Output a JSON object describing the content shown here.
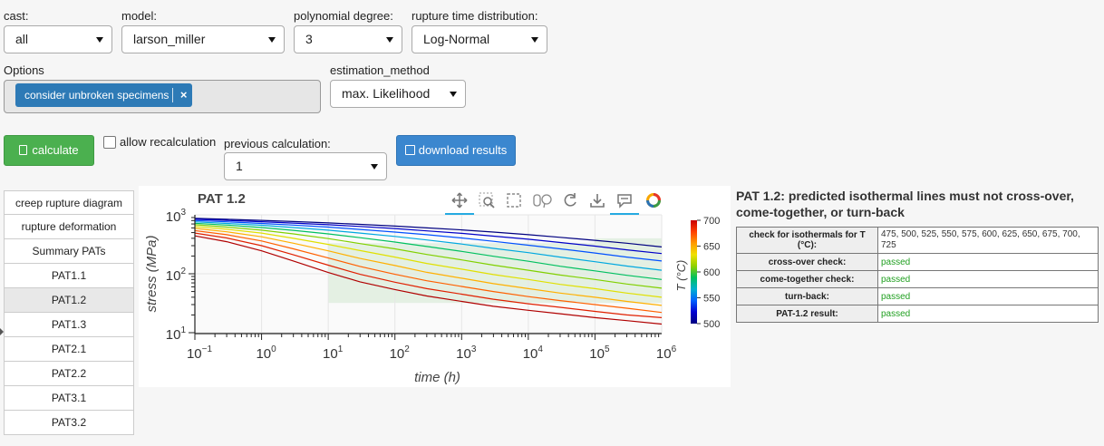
{
  "controls": {
    "cast": {
      "label": "cast:",
      "value": "all"
    },
    "model": {
      "label": "model:",
      "value": "larson_miller"
    },
    "poly_degree": {
      "label": "polynomial degree:",
      "value": "3"
    },
    "rupture_dist": {
      "label": "rupture time distribution:",
      "value": "Log-Normal"
    },
    "options": {
      "label": "Options",
      "chip": "consider unbroken specimens"
    },
    "estimation": {
      "label": "estimation_method",
      "value": "max. Likelihood"
    },
    "calculate_label": "calculate",
    "allow_recalc_label": "allow recalculation",
    "allow_recalc_checked": false,
    "previous": {
      "label": "previous calculation:",
      "value": "1"
    },
    "download_label": "download results"
  },
  "tabs": [
    "creep rupture diagram",
    "rupture deformation",
    "Summary PATs",
    "PAT1.1",
    "PAT1.2",
    "PAT1.3",
    "PAT2.1",
    "PAT2.2",
    "PAT3.1",
    "PAT3.2"
  ],
  "active_tab": "PAT1.2",
  "toolbar": [
    "pan-icon",
    "box-zoom-icon",
    "box-select-icon",
    "lasso-select-icon",
    "reset-icon",
    "save-icon",
    "hover-icon",
    "bokeh-logo-icon"
  ],
  "chart_data": {
    "type": "line",
    "title": "PAT 1.2",
    "xlabel": "time (h)",
    "ylabel": "stress (MPa)",
    "x_scale": "log",
    "y_scale": "log",
    "xlim": [
      0.1,
      1000000
    ],
    "ylim": [
      10,
      1000
    ],
    "x_ticks": [
      {
        "v": 0.1,
        "b": "10",
        "e": "−1"
      },
      {
        "v": 1,
        "b": "10",
        "e": "0"
      },
      {
        "v": 10,
        "b": "10",
        "e": "1"
      },
      {
        "v": 100,
        "b": "10",
        "e": "2"
      },
      {
        "v": 1000,
        "b": "10",
        "e": "3"
      },
      {
        "v": 10000,
        "b": "10",
        "e": "4"
      },
      {
        "v": 100000,
        "b": "10",
        "e": "5"
      },
      {
        "v": 1000000,
        "b": "10",
        "e": "6"
      }
    ],
    "y_ticks": [
      {
        "v": 10,
        "b": "10",
        "e": "1"
      },
      {
        "v": 100,
        "b": "10",
        "e": "2"
      },
      {
        "v": 1000,
        "b": "10",
        "e": "3"
      }
    ],
    "shaded_regions": [
      {
        "x": [
          10,
          1000000
        ],
        "y": [
          32,
          330
        ]
      },
      {
        "x": 100000,
        "x2": 1000000,
        "y": [
          330,
          400
        ]
      }
    ],
    "colorbar": {
      "label": "T (°C)",
      "ticks": [
        "700",
        "650",
        "600",
        "550",
        "500"
      ],
      "min": 500,
      "max": 700
    },
    "x": [
      0.1,
      0.3,
      1,
      3,
      10,
      30,
      100,
      300,
      1000,
      3000,
      10000,
      30000,
      100000,
      300000,
      1000000
    ],
    "series": [
      {
        "temp": 475,
        "color": "#000080",
        "values": [
          870,
          840,
          805,
          770,
          730,
          690,
          645,
          600,
          555,
          510,
          460,
          415,
          370,
          330,
          285
        ]
      },
      {
        "temp": 500,
        "color": "#0000c8",
        "values": [
          840,
          805,
          765,
          725,
          680,
          635,
          585,
          535,
          485,
          435,
          385,
          340,
          295,
          255,
          220
        ]
      },
      {
        "temp": 525,
        "color": "#0050ff",
        "values": [
          800,
          760,
          715,
          670,
          620,
          565,
          510,
          460,
          405,
          355,
          305,
          265,
          225,
          192,
          165
        ]
      },
      {
        "temp": 550,
        "color": "#00a8e0",
        "values": [
          760,
          715,
          665,
          610,
          550,
          490,
          430,
          375,
          320,
          270,
          228,
          192,
          160,
          135,
          115
        ]
      },
      {
        "temp": 575,
        "color": "#00c060",
        "values": [
          720,
          670,
          610,
          545,
          475,
          410,
          345,
          290,
          240,
          198,
          163,
          134,
          112,
          94,
          80
        ]
      },
      {
        "temp": 600,
        "color": "#80d000",
        "values": [
          680,
          620,
          550,
          475,
          395,
          325,
          265,
          213,
          172,
          140,
          115,
          95,
          80,
          67,
          57
        ]
      },
      {
        "temp": 625,
        "color": "#e0e000",
        "values": [
          635,
          570,
          490,
          400,
          315,
          248,
          192,
          150,
          120,
          97,
          80,
          66,
          56,
          47,
          40
        ]
      },
      {
        "temp": 650,
        "color": "#ffb000",
        "values": [
          590,
          515,
          425,
          330,
          245,
          182,
          138,
          106,
          84,
          68,
          56,
          47,
          40,
          34,
          29
        ]
      },
      {
        "temp": 675,
        "color": "#ff6000",
        "values": [
          540,
          460,
          360,
          265,
          185,
          133,
          98,
          76,
          61,
          50,
          41,
          35,
          30,
          26,
          22
        ]
      },
      {
        "temp": 700,
        "color": "#e02000",
        "values": [
          490,
          405,
          300,
          210,
          140,
          98,
          72,
          56,
          45,
          37,
          31,
          27,
          23,
          20,
          18
        ]
      },
      {
        "temp": 725,
        "color": "#b00000",
        "values": [
          440,
          350,
          245,
          165,
          105,
          73,
          54,
          42,
          34,
          28,
          24,
          21,
          18,
          16,
          14
        ]
      }
    ]
  },
  "pat": {
    "title": "PAT 1.2: predicted isothermal lines must not cross-over, come-together, or turn-back",
    "rows": [
      {
        "label": "check for isothermals for T (°C):",
        "value": "475, 500, 525, 550, 575, 600, 625, 650, 675, 700, 725"
      },
      {
        "label": "cross-over check:",
        "value": "passed"
      },
      {
        "label": "come-together check:",
        "value": "passed"
      },
      {
        "label": "turn-back:",
        "value": "passed"
      },
      {
        "label": "PAT-1.2 result:",
        "value": "passed"
      }
    ]
  }
}
